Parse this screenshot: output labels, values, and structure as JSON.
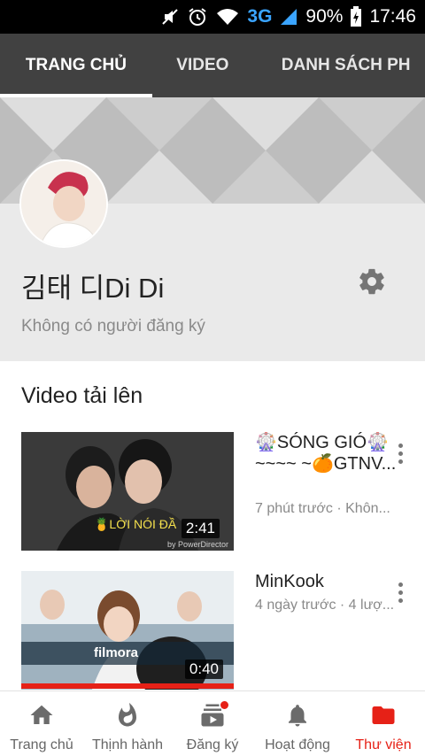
{
  "status_bar": {
    "network": "3G",
    "battery": "90%",
    "time": "17:46"
  },
  "tabs": [
    {
      "label": "TRANG CHỦ",
      "active": true
    },
    {
      "label": "VIDEO",
      "active": false
    },
    {
      "label": "DANH SÁCH PH",
      "active": false
    }
  ],
  "channel": {
    "name": "김태 디Di Di",
    "subscribers": "Không có người đăng ký"
  },
  "uploads": {
    "section_title": "Video tải lên",
    "videos": [
      {
        "title": "🎡SÓNG GIÓ🎡~~~~ ~🍊GTNV...",
        "meta": "7 phút trước · Khôn...",
        "duration": "2:41",
        "thumb_caption": "🍍LỜI NÓI ĐẦ",
        "thumb_watermark": "by PowerDirector"
      },
      {
        "title": "MinKook",
        "meta": "4 ngày trước · 4 lượ...",
        "duration": "0:40",
        "thumb_watermark": "filmora"
      }
    ]
  },
  "bottom_nav": [
    {
      "label": "Trang chủ",
      "icon": "home-icon",
      "active": false
    },
    {
      "label": "Thịnh hành",
      "icon": "flame-icon",
      "active": false
    },
    {
      "label": "Đăng ký",
      "icon": "subscriptions-icon",
      "active": false
    },
    {
      "label": "Hoạt động",
      "icon": "bell-icon",
      "active": false
    },
    {
      "label": "Thư viện",
      "icon": "folder-icon",
      "active": true
    }
  ],
  "colors": {
    "accent": "#e62117",
    "tab_bar": "#414141",
    "status_bar": "#000000"
  }
}
